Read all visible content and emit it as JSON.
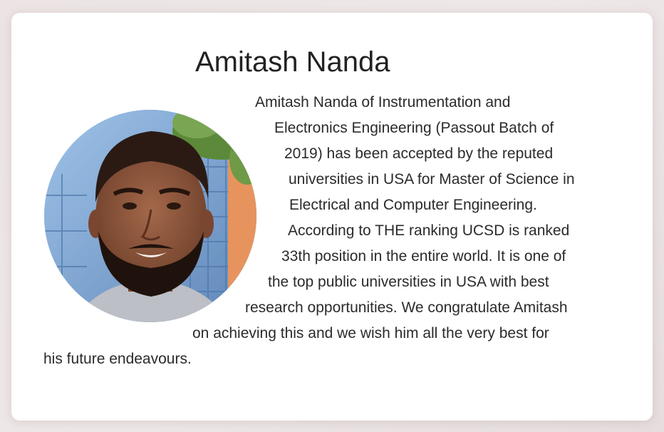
{
  "profile": {
    "name": "Amitash Nanda",
    "photo_description": "portrait-photo",
    "bio_lines": [
      "Amitash Nanda of Instrumentation and",
      "Electronics Engineering (Passout Batch of",
      "2019) has been accepted by the reputed",
      "universities in USA for Master of Science in",
      "Electrical and Computer Engineering.",
      "According to THE ranking UCSD is ranked",
      "33th position in the entire world. It is one of",
      "the top public universities in USA with best",
      "research opportunities. We congratulate Amitash",
      "on achieving this and we wish him all the very best for",
      "his future endeavours."
    ]
  },
  "colors": {
    "page_background": "#ece4e4",
    "card_background": "#ffffff",
    "text": "#2b2b2b"
  }
}
